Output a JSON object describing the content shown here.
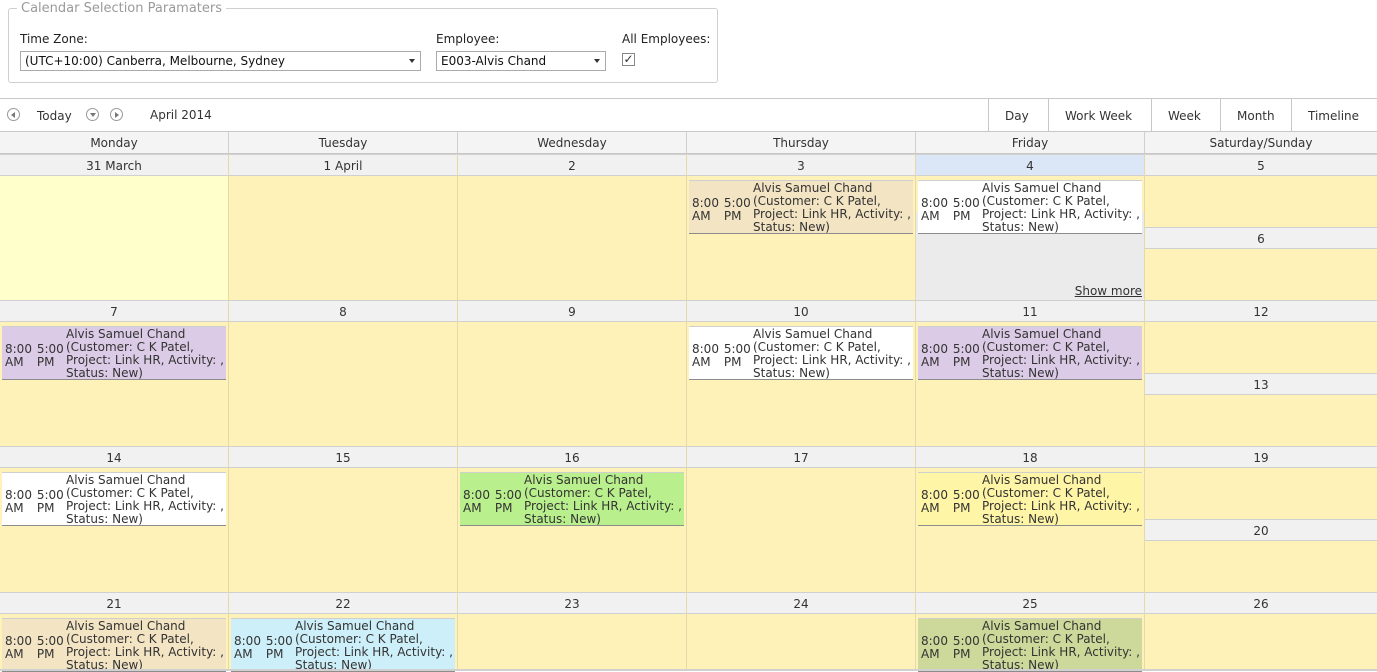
{
  "params": {
    "legend": "Calendar Selection Paramaters",
    "timezone_label": "Time Zone:",
    "timezone_value": "(UTC+10:00) Canberra, Melbourne, Sydney",
    "employee_label": "Employee:",
    "employee_value": "E003-Alvis Chand",
    "all_employees_label": "All Employees:",
    "all_employees_checked": "✓"
  },
  "toolbar": {
    "today": "Today",
    "period": "April 2014",
    "views": [
      "Day",
      "Work Week",
      "Week",
      "Month",
      "Timeline"
    ]
  },
  "day_headers": [
    "Monday",
    "Tuesday",
    "Wednesday",
    "Thursday",
    "Friday",
    "Saturday/Sunday"
  ],
  "appointment": {
    "name": "Alvis Samuel Chand",
    "line2": "(Customer: C K Patel,",
    "line3": "Project: Link HR, Activity: ,",
    "line4": "Status: New)",
    "start": "8:00",
    "end": "5:00",
    "start_ampm": "AM",
    "end_ampm": "PM"
  },
  "show_more": "Show more",
  "weeks": [
    {
      "days": [
        "31 March",
        "1 April",
        "2",
        "3",
        "4"
      ],
      "sat": "5",
      "sun": "6"
    },
    {
      "days": [
        "7",
        "8",
        "9",
        "10",
        "11"
      ],
      "sat": "12",
      "sun": "13"
    },
    {
      "days": [
        "14",
        "15",
        "16",
        "17",
        "18"
      ],
      "sat": "19",
      "sun": "20"
    },
    {
      "days": [
        "21",
        "22",
        "23",
        "24",
        "25"
      ],
      "sat": "26",
      "sun": ""
    }
  ],
  "colors": {
    "beige": "#f3e4c3",
    "white": "#ffffff",
    "lavender": "#dccbe6",
    "green": "#b9f08d",
    "yellow": "#fff5a6",
    "cyan": "#cdeff9",
    "olive": "#ccd99a"
  }
}
